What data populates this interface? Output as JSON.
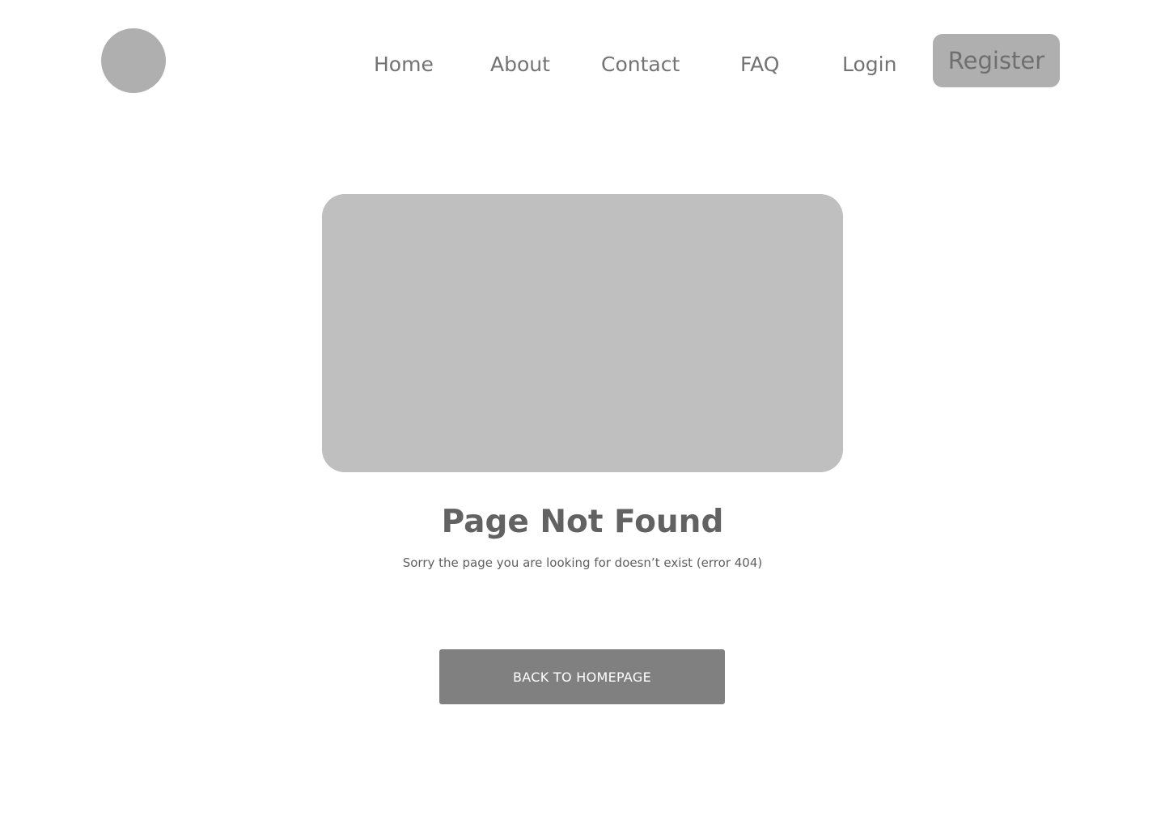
{
  "header": {
    "logo": "logo-placeholder",
    "nav": {
      "home": "Home",
      "about": "About",
      "contact": "Contact",
      "faq": "FAQ",
      "login": "Login",
      "register": "Register"
    }
  },
  "main": {
    "image": "image-placeholder",
    "title": "Page Not Found",
    "subtitle": "Sorry the page you are looking for doesn’t exist (error 404)",
    "cta": "BACK TO HOMEPAGE"
  },
  "colors": {
    "background": "#ffffff",
    "placeholder": "#bfbfbf",
    "logo": "#afafaf",
    "nav_text": "#737373",
    "button": "#808080",
    "button_text": "#ffffff"
  }
}
